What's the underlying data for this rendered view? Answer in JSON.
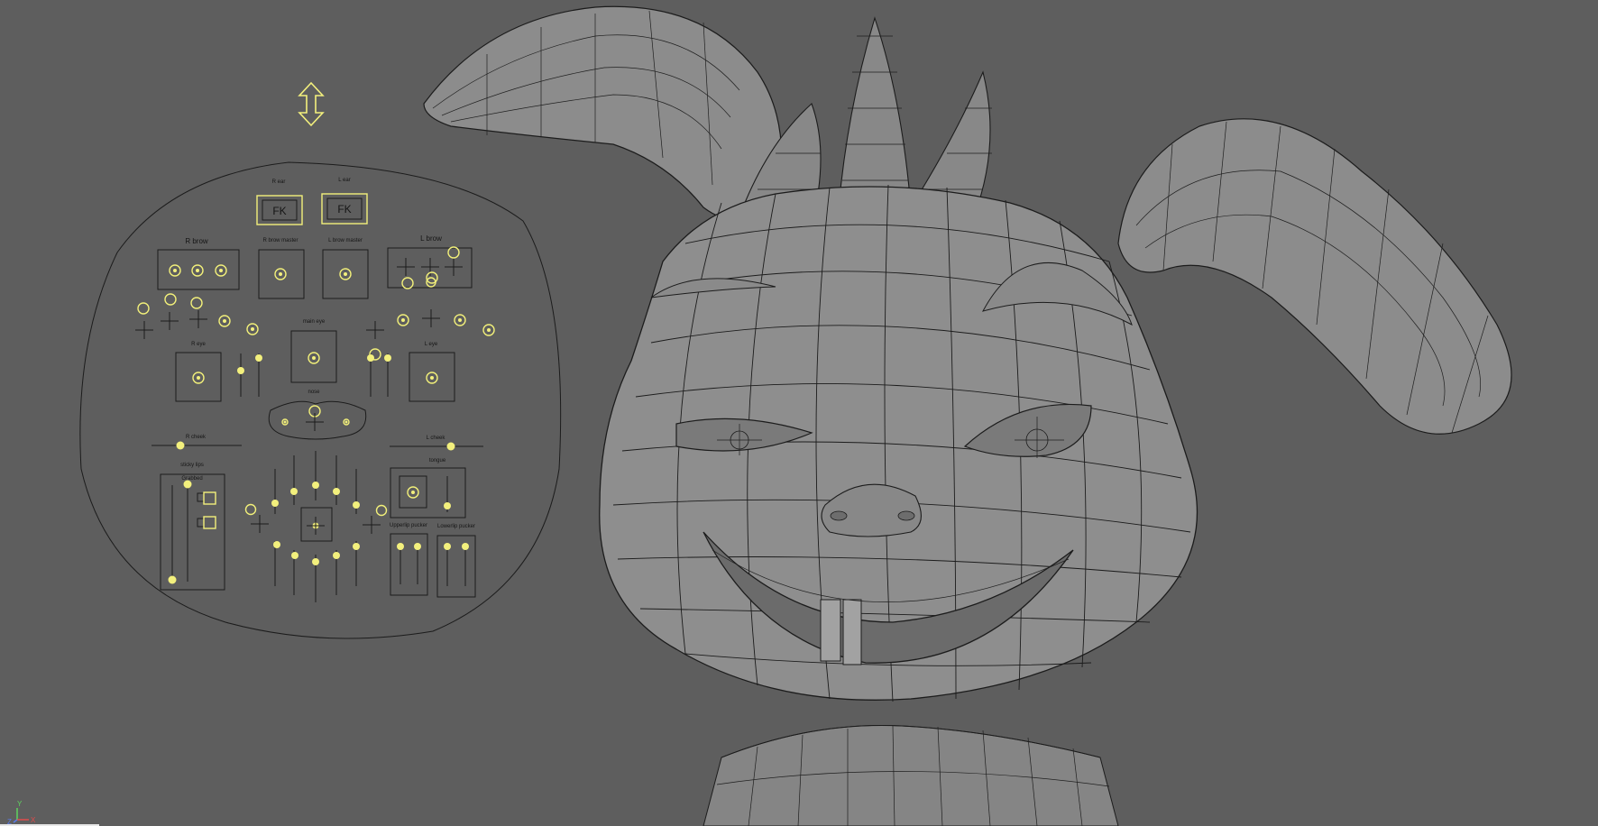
{
  "viewport": {
    "background": "#5e5e5e",
    "controller_color": "#f3f07d",
    "mesh_fill": "#8e8e8e",
    "wire_color": "#1c1c1c"
  },
  "picker": {
    "r_ear": "R ear",
    "l_ear": "L ear",
    "r_ear_button": "FK",
    "l_ear_button": "FK",
    "r_brow": "R brow",
    "r_brow_master": "R brow master",
    "l_brow_master": "L brow master",
    "l_brow": "L brow",
    "main_eye": "main eye",
    "r_eye": "R eye",
    "l_eye": "L eye",
    "nose": "nose",
    "r_cheek": "R cheek",
    "l_cheek": "L cheek",
    "sticky_lips": "sticky lips",
    "sticky_lips_sub": "Grabbed",
    "tongue": "tongue",
    "upperlip_pucker": "Upperlip pucker",
    "lowerlip_pucker": "Lowerlip pucker"
  },
  "axis": {
    "y": "Y",
    "x": "X",
    "z": "Z"
  }
}
